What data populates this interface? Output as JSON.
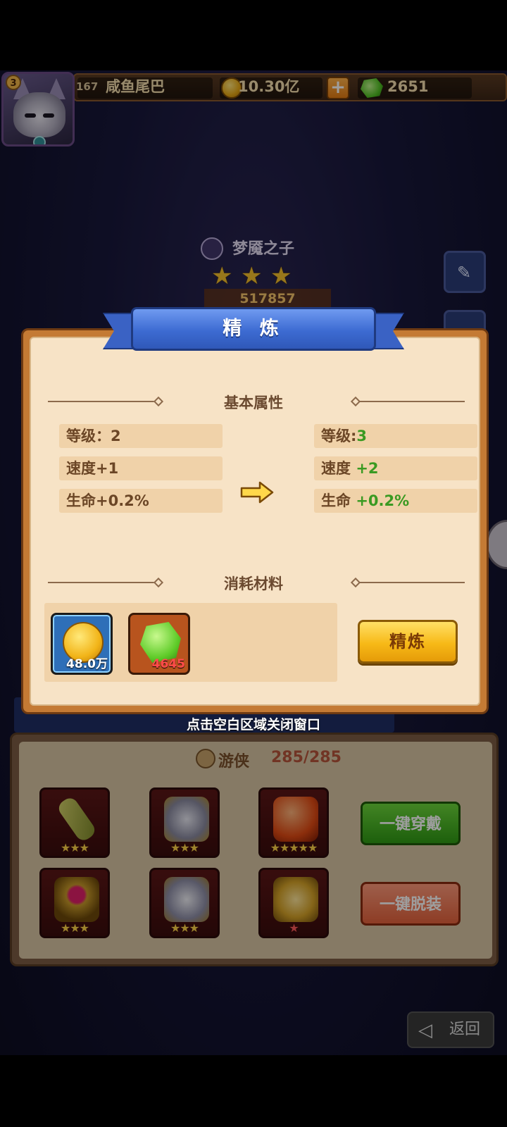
{
  "player": {
    "level_badge": "3",
    "level": "167",
    "name": "咸鱼尾巴",
    "gold": "10.30亿",
    "gems": "2651"
  },
  "hero": {
    "name": "梦魇之子",
    "stars": 3,
    "power": "517857"
  },
  "modal": {
    "title": "精 炼",
    "section_basic": "基本属性",
    "section_materials": "消耗材料",
    "current": {
      "level": "等级：2",
      "speed": "速度+1",
      "life": "生命+0.2%"
    },
    "next": {
      "level_label": "等级:",
      "level_value": "3",
      "speed_label": "速度",
      "speed_value": "+2",
      "life_label": "生命",
      "life_value": "+0.2%"
    },
    "materials": [
      {
        "icon": "gold-coin-icon",
        "amount": "48.0万",
        "amount_color": "#ffffff"
      },
      {
        "icon": "green-gem-icon",
        "amount": "4645",
        "amount_color": "#ff4b4b"
      }
    ],
    "refine_button": "精炼",
    "close_hint": "点击空白区域关闭窗口"
  },
  "equipment": {
    "class_name": "游侠",
    "count": "285/285",
    "wear_all_button": "一键穿戴",
    "remove_all_button": "一键脱装"
  },
  "return_button": "返回"
}
